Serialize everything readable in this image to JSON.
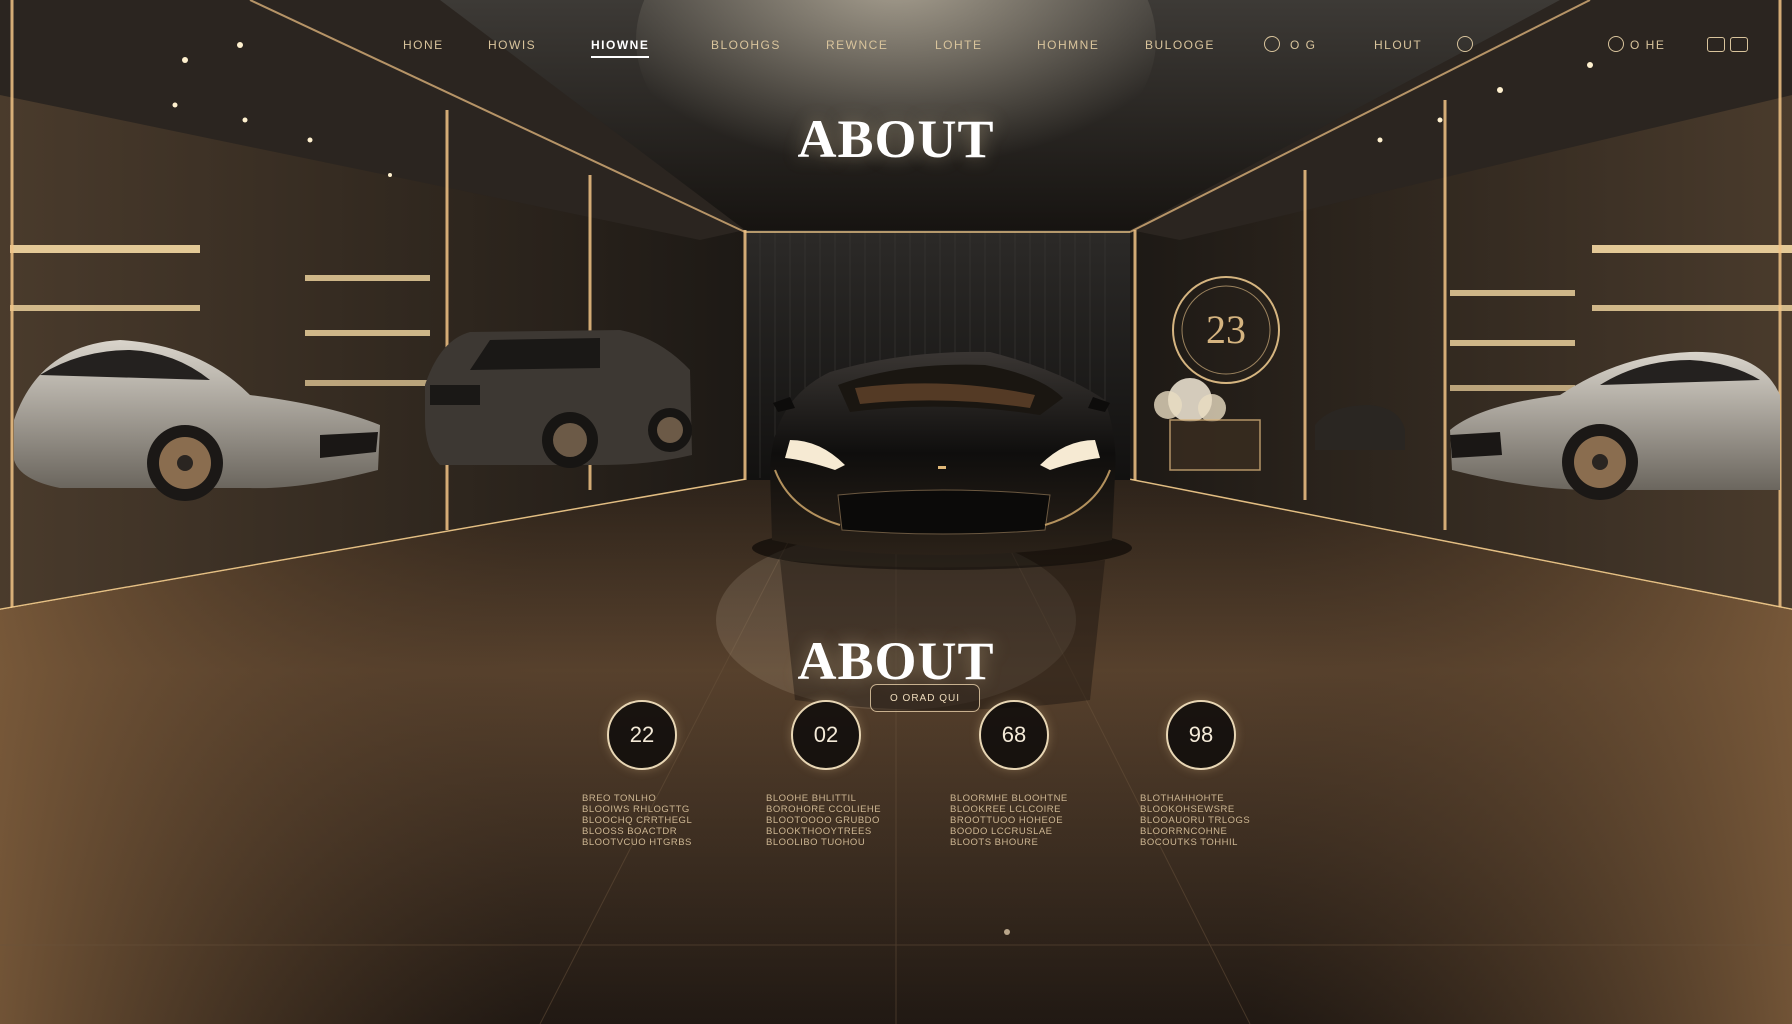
{
  "nav": {
    "items": [
      {
        "label": "HONE",
        "active": false
      },
      {
        "label": "HOWIS",
        "active": false
      },
      {
        "label": "HIOWNE",
        "active": true
      },
      {
        "label": "BLOOHGS",
        "active": false
      },
      {
        "label": "REWNCE",
        "active": false
      },
      {
        "label": "LOHTE",
        "active": false
      },
      {
        "label": "HOHMNE",
        "active": false
      },
      {
        "label": "BULOOGE",
        "active": false
      },
      {
        "label": "O G",
        "active": false
      },
      {
        "label": "HLOUT",
        "active": false
      }
    ],
    "right_text": "O HE",
    "icons": [
      "circle-icon",
      "circle-icon",
      "circle-icon",
      "square-icon",
      "square-icon"
    ]
  },
  "heading_top": "ABOUT",
  "heading_main": "ABOUT",
  "cta_label": "O ORAD QUI",
  "showroom_badge": "23",
  "stats": [
    {
      "value": "22",
      "lines": [
        "BREO TONLHO",
        "BLOOIWS RHLOGTTG",
        "BLOOCHQ CRRTHEGL",
        "BLOOSS BOACTDR",
        "BLOOTVCUO HTGRBS"
      ]
    },
    {
      "value": "02",
      "lines": [
        "BLOOHE BHLITTIL",
        "BOROHORE CCOLIEHE",
        "BLOOTOOOO GRUBDO",
        "BLOOKTHOOYTREES",
        "BLOOLIBO TUOHOU"
      ]
    },
    {
      "value": "68",
      "lines": [
        "BLOORMHE BLOOHTNE",
        "BLOOKREE LCLCOIRE",
        "BROOTTUOO HOHEOE",
        "BOODO LCCRUSLAE",
        "BLOOTS BHOURE"
      ]
    },
    {
      "value": "98",
      "lines": [
        "BLOTHAHHOHTE",
        "BLOOKOHSEWSRE",
        "BLOOAUORU TRLOGS",
        "BLOORRNCOHNE",
        "BOCOUTKS TOHHIL"
      ]
    }
  ],
  "colors": {
    "accent": "#d9b070",
    "text": "#f3e6cf",
    "dark": "#0d0b09"
  }
}
